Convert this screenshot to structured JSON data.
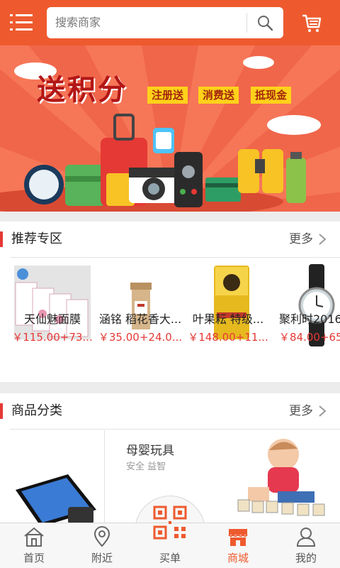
{
  "header": {
    "search_placeholder": "搜索商家",
    "icons": {
      "menu": "menu-icon",
      "search": "search-icon",
      "cart": "cart-icon"
    },
    "accent_color": "#ee5a2e"
  },
  "banner": {
    "title": "送积分",
    "tags": [
      "注册送",
      "消费送",
      "抵现金"
    ]
  },
  "recommended": {
    "title": "推荐专区",
    "more": "更多",
    "products": [
      {
        "name": "天仙魅面膜",
        "price": "￥115.00+73..."
      },
      {
        "name": "涵铭 稻花香大...",
        "price": "￥35.00+24.0..."
      },
      {
        "name": "叶果耘 特级...",
        "price": "￥148.00+11..."
      },
      {
        "name": "聚利时2016",
        "price": "￥84.00+65"
      }
    ]
  },
  "categories": {
    "title": "商品分类",
    "more": "更多",
    "featured": {
      "title": "母婴玩具",
      "subtitle": "安全 益智"
    }
  },
  "nav": {
    "items": [
      {
        "label": "首页",
        "icon": "home-icon"
      },
      {
        "label": "附近",
        "icon": "location-icon"
      },
      {
        "label": "买单",
        "icon": "qr-code-icon"
      },
      {
        "label": "商城",
        "icon": "store-icon",
        "active": true
      },
      {
        "label": "我的",
        "icon": "user-icon"
      }
    ]
  }
}
